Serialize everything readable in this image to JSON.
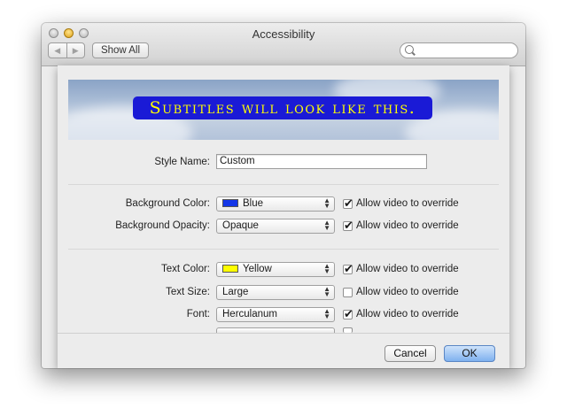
{
  "window": {
    "title": "Accessibility",
    "nav_back": "◀",
    "nav_forward": "▶",
    "show_all": "Show All",
    "search_placeholder": ""
  },
  "preview": {
    "caption": "Subtitles will look like this.",
    "caption_bg": "#1a1ad6",
    "caption_fg": "#ffff00"
  },
  "style_name": {
    "label": "Style Name:",
    "value": "Custom"
  },
  "rows": [
    {
      "label": "Background Color:",
      "value": "Blue",
      "swatch": "#1336e8",
      "checked": true,
      "check_label": "Allow video to override"
    },
    {
      "label": "Background Opacity:",
      "value": "Opaque",
      "checked": true,
      "check_label": "Allow video to override"
    },
    {
      "label": "Text Color:",
      "value": "Yellow",
      "swatch": "#ffff00",
      "checked": true,
      "check_label": "Allow video to override"
    },
    {
      "label": "Text Size:",
      "value": "Large",
      "checked": false,
      "check_label": "Allow video to override"
    },
    {
      "label": "Font:",
      "value": "Herculanum",
      "checked": true,
      "check_label": "Allow video to override"
    }
  ],
  "buttons": {
    "cancel": "Cancel",
    "ok": "OK"
  }
}
